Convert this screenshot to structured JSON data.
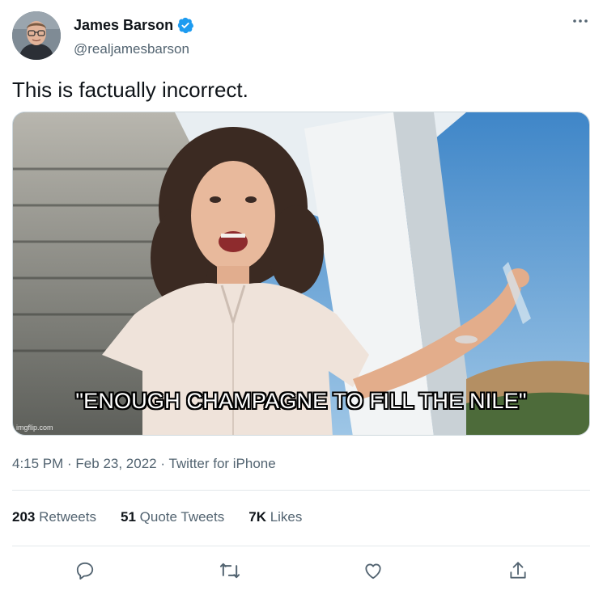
{
  "user": {
    "display_name": "James Barson",
    "handle": "@realjamesbarson",
    "verified": true,
    "verified_color": "#1d9bf0"
  },
  "tweet": {
    "text": "This is factually incorrect."
  },
  "media": {
    "caption": "\"ENOUGH CHAMPAGNE TO FILL THE NILE\"",
    "watermark": "imgflip.com"
  },
  "meta": {
    "time": "4:15 PM",
    "separator": " · ",
    "date": "Feb 23, 2022",
    "source": "Twitter for iPhone"
  },
  "stats": {
    "retweets_count": "203",
    "retweets_label": "Retweets",
    "quotes_count": "51",
    "quotes_label": "Quote Tweets",
    "likes_count": "7K",
    "likes_label": "Likes"
  },
  "icons": {
    "more": "more-dots-icon",
    "reply": "reply-icon",
    "retweet": "retweet-icon",
    "like": "heart-icon",
    "share": "share-icon"
  }
}
